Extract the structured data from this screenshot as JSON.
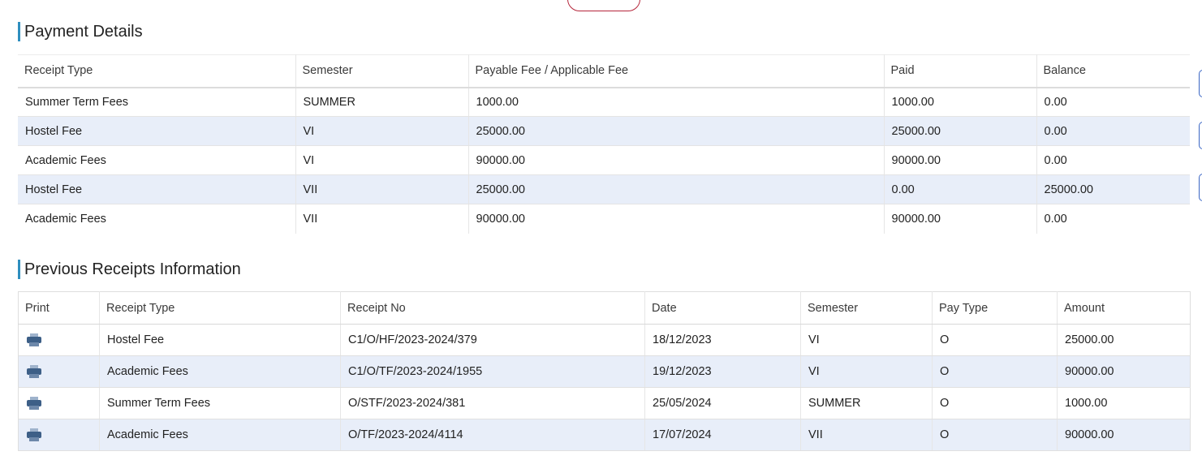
{
  "payment_details": {
    "title": "Payment Details",
    "headers": [
      "Receipt Type",
      "Semester",
      "Payable Fee / Applicable Fee",
      "Paid",
      "Balance"
    ],
    "rows": [
      [
        "Summer Term Fees",
        "SUMMER",
        "1000.00",
        "1000.00",
        "0.00"
      ],
      [
        "Hostel Fee",
        "VI",
        "25000.00",
        "25000.00",
        "0.00"
      ],
      [
        "Academic Fees",
        "VI",
        "90000.00",
        "90000.00",
        "0.00"
      ],
      [
        "Hostel Fee",
        "VII",
        "25000.00",
        "0.00",
        "25000.00"
      ],
      [
        "Academic Fees",
        "VII",
        "90000.00",
        "90000.00",
        "0.00"
      ]
    ]
  },
  "previous_receipts": {
    "title": "Previous Receipts Information",
    "headers": [
      "Print",
      "Receipt Type",
      "Receipt No",
      "Date",
      "Semester",
      "Pay Type",
      "Amount"
    ],
    "print_icon": "printer-icon",
    "rows": [
      [
        "Hostel Fee",
        "C1/O/HF/2023-2024/379",
        "18/12/2023",
        "VI",
        "O",
        "25000.00"
      ],
      [
        "Academic Fees",
        "C1/O/TF/2023-2024/1955",
        "19/12/2023",
        "VI",
        "O",
        "90000.00"
      ],
      [
        "Summer Term Fees",
        "O/STF/2023-2024/381",
        "25/05/2024",
        "SUMMER",
        "O",
        "1000.00"
      ],
      [
        "Academic Fees",
        "O/TF/2023-2024/4114",
        "17/07/2024",
        "VII",
        "O",
        "90000.00"
      ]
    ]
  },
  "colors": {
    "accent_bar": "#2f8fbf",
    "alt_row": "#e8eef9",
    "pill_border": "#b5253a",
    "side_tab_border": "#3a66c4"
  }
}
